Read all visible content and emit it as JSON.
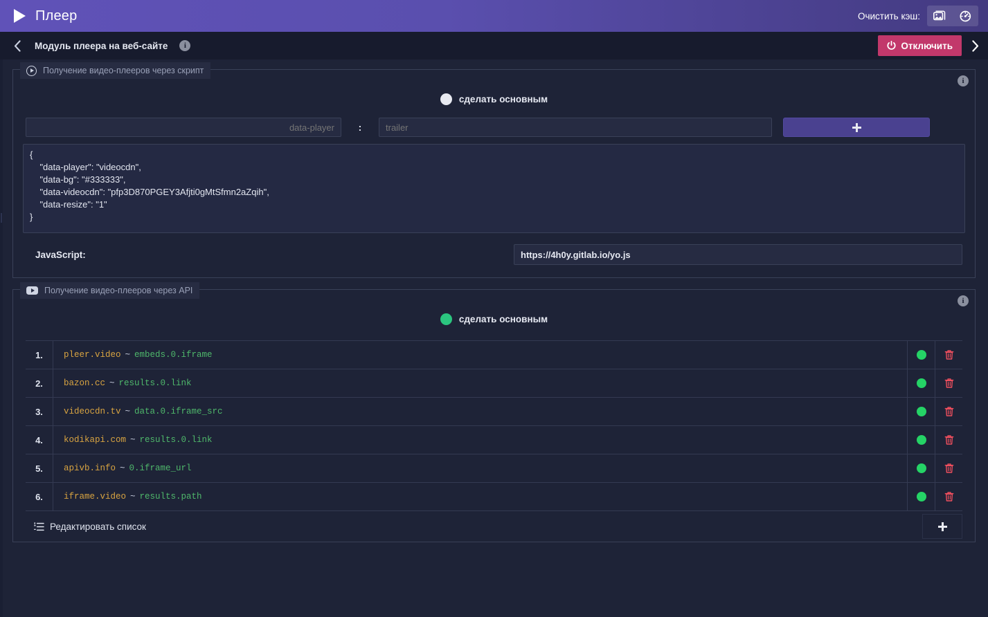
{
  "app": {
    "title": "Плеер",
    "play_icon": "play-triangle-icon"
  },
  "header": {
    "cache_label": "Очистить кэш:",
    "cache_buttons": [
      {
        "name": "images-cache-icon",
        "title": "images"
      },
      {
        "name": "speed-cache-icon",
        "title": "speed"
      }
    ]
  },
  "subheader": {
    "back_icon": "chevron-left-icon",
    "title": "Модуль плеера на веб-сайте",
    "info_icon": "info-icon",
    "disable_label": "Отключить",
    "power_icon": "power-icon",
    "forward_icon": "chevron-right-icon"
  },
  "script_card": {
    "legend": "Получение видео-плееров через скрипт",
    "legend_icon": "play-circle-icon",
    "info_icon": "info-icon",
    "toggle": {
      "label": "сделать основным",
      "active": false,
      "color": "#e8eaf1"
    },
    "param": {
      "key_value": "",
      "key_placeholder": "data-player",
      "separator": ":",
      "value_value": "",
      "value_placeholder": "trailer",
      "add_icon": "plus-icon"
    },
    "json_text": "{\n    \"data-player\": \"videocdn\",\n    \"data-bg\": \"#333333\",\n    \"data-videocdn\": \"pfp3D870PGEY3Afjti0gMtSfmn2aZqih\",\n    \"data-resize\": \"1\"\n}",
    "javascript": {
      "label": "JavaScript:",
      "value": "https://4h0y.gitlab.io/yo.js",
      "placeholder": ""
    }
  },
  "api_card": {
    "legend": "Получение видео-плееров через API",
    "legend_icon": "youtube-icon",
    "info_icon": "info-icon",
    "toggle": {
      "label": "сделать основным",
      "active": true,
      "color": "#2bc57f"
    },
    "rows": [
      {
        "num": "1.",
        "source": "pleer.video",
        "tilde": "~",
        "path": "embeds.0.iframe",
        "status": "on",
        "delete_icon": "trash-icon"
      },
      {
        "num": "2.",
        "source": "bazon.cc",
        "tilde": "~",
        "path": "results.0.link",
        "status": "on",
        "delete_icon": "trash-icon"
      },
      {
        "num": "3.",
        "source": "videocdn.tv",
        "tilde": "~",
        "path": "data.0.iframe_src",
        "status": "on",
        "delete_icon": "trash-icon"
      },
      {
        "num": "4.",
        "source": "kodikapi.com",
        "tilde": "~",
        "path": "results.0.link",
        "status": "on",
        "delete_icon": "trash-icon"
      },
      {
        "num": "5.",
        "source": "apivb.info",
        "tilde": "~",
        "path": "0.iframe_url",
        "status": "on",
        "delete_icon": "trash-icon"
      },
      {
        "num": "6.",
        "source": "iframe.video",
        "tilde": "~",
        "path": "results.path",
        "status": "on",
        "delete_icon": "trash-icon"
      }
    ],
    "footer": {
      "edit_label": "Редактировать список",
      "edit_icon": "list-ordered-icon",
      "add_icon": "plus-icon"
    }
  },
  "colors": {
    "accent_purple": "#5a4fae",
    "danger_pink": "#c2386b",
    "status_green": "#25d366",
    "source_orange": "#d9a441",
    "path_green": "#4fb86b",
    "page_bg": "#1e2337"
  }
}
